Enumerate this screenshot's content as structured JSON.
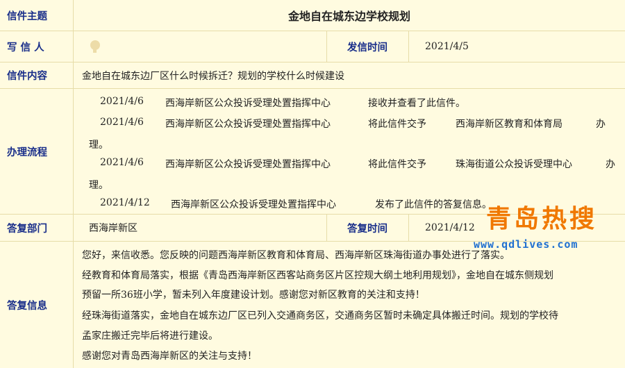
{
  "subject": {
    "label": "信件主题",
    "value": "金地自在城东边学校规划"
  },
  "writer": {
    "label": "写 信 人",
    "time_label": "发信时间",
    "time_value": "2021/4/5"
  },
  "content": {
    "label": "信件内容",
    "value": "金地自在城东边厂区什么时候拆迁？规划的学校什么时候建设"
  },
  "process": {
    "label": "办理流程",
    "lines": [
      {
        "date": "2021/4/6",
        "dept": "西海岸新区公众投诉受理处置指挥中心",
        "action": "接收并查看了此信件。"
      },
      {
        "date": "2021/4/6",
        "dept": "西海岸新区公众投诉受理处置指挥中心",
        "action": "将此信件交予",
        "target": "西海岸新区教育和体育局",
        "tail": "办",
        "wrap": "理。"
      },
      {
        "date": "2021/4/6",
        "dept": "西海岸新区公众投诉受理处置指挥中心",
        "action": "将此信件交予",
        "target": "珠海街道公众投诉受理中心",
        "tail": "办",
        "wrap": "理。"
      },
      {
        "date": "2021/4/12",
        "dept": "西海岸新区公众投诉受理处置指挥中心",
        "action": "发布了此信件的答复信息。"
      }
    ]
  },
  "reply_dept": {
    "label": "答复部门",
    "value": "西海岸新区",
    "time_label": "答复时间",
    "time_value": "2021/4/12"
  },
  "reply": {
    "label": "答复信息",
    "lines": [
      "您好，来信收悉。您反映的问题西海岸新区教育和体育局、西海岸新区珠海街道办事处进行了落实。",
      "经教育和体育局落实，根据《青岛西海岸新区西客站商务区片区控规大纲土地利用规划》，金地自在城东侧规划",
      "预留一所36班小学，暂未列入年度建设计划。感谢您对新区教育的关注和支持！",
      "经珠海街道落实，金地自在城东边厂区已列入交通商务区，交通商务区暂时未确定具体搬迁时间。规划的学校待",
      "孟家庄搬迁完毕后将进行建设。",
      "感谢您对青岛西海岸新区的关注与支持！"
    ]
  },
  "watermark": {
    "title": "青岛热搜",
    "url": "www.qdlives.com"
  }
}
